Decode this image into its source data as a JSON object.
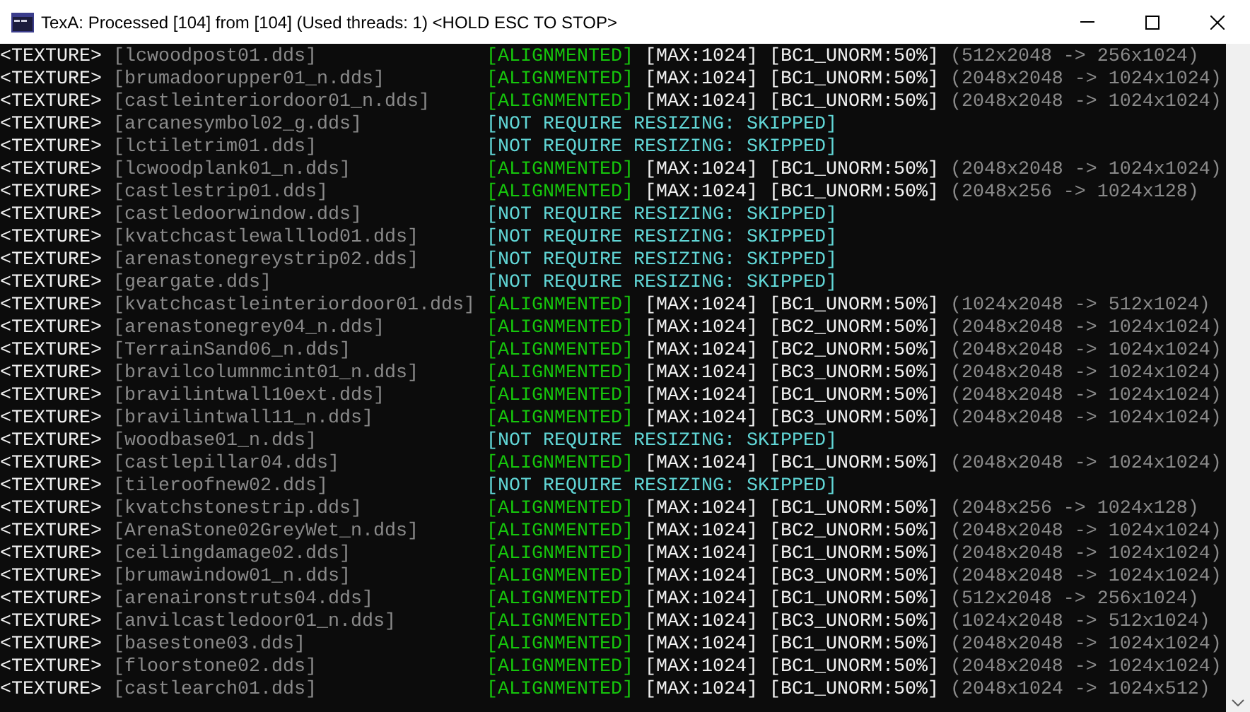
{
  "window": {
    "title": "TexA: Processed [104] from [104] (Used threads: 1) <HOLD ESC TO STOP>"
  },
  "rows": [
    {
      "kind": "aligned",
      "tag": "<TEXTURE>",
      "name": "[lcwoodpost01.dds]",
      "status": "[ALIGNMENTED]",
      "max": "[MAX:1024]",
      "format": "[BC1_UNORM:50%]",
      "dims": "(512x2048 -> 256x1024)"
    },
    {
      "kind": "aligned",
      "tag": "<TEXTURE>",
      "name": "[brumadoorupper01_n.dds]",
      "status": "[ALIGNMENTED]",
      "max": "[MAX:1024]",
      "format": "[BC1_UNORM:50%]",
      "dims": "(2048x2048 -> 1024x1024)"
    },
    {
      "kind": "aligned",
      "tag": "<TEXTURE>",
      "name": "[castleinteriordoor01_n.dds]",
      "status": "[ALIGNMENTED]",
      "max": "[MAX:1024]",
      "format": "[BC1_UNORM:50%]",
      "dims": "(2048x2048 -> 1024x1024)"
    },
    {
      "kind": "skipped",
      "tag": "<TEXTURE>",
      "name": "[arcanesymbol02_g.dds]",
      "status": "[NOT REQUIRE RESIZING: SKIPPED]"
    },
    {
      "kind": "skipped",
      "tag": "<TEXTURE>",
      "name": "[lctiletrim01.dds]",
      "status": "[NOT REQUIRE RESIZING: SKIPPED]"
    },
    {
      "kind": "aligned",
      "tag": "<TEXTURE>",
      "name": "[lcwoodplank01_n.dds]",
      "status": "[ALIGNMENTED]",
      "max": "[MAX:1024]",
      "format": "[BC1_UNORM:50%]",
      "dims": "(2048x2048 -> 1024x1024)"
    },
    {
      "kind": "aligned",
      "tag": "<TEXTURE>",
      "name": "[castlestrip01.dds]",
      "status": "[ALIGNMENTED]",
      "max": "[MAX:1024]",
      "format": "[BC1_UNORM:50%]",
      "dims": "(2048x256 -> 1024x128)"
    },
    {
      "kind": "skipped",
      "tag": "<TEXTURE>",
      "name": "[castledoorwindow.dds]",
      "status": "[NOT REQUIRE RESIZING: SKIPPED]"
    },
    {
      "kind": "skipped",
      "tag": "<TEXTURE>",
      "name": "[kvatchcastlewalllod01.dds]",
      "status": "[NOT REQUIRE RESIZING: SKIPPED]"
    },
    {
      "kind": "skipped",
      "tag": "<TEXTURE>",
      "name": "[arenastonegreystrip02.dds]",
      "status": "[NOT REQUIRE RESIZING: SKIPPED]"
    },
    {
      "kind": "skipped",
      "tag": "<TEXTURE>",
      "name": "[geargate.dds]",
      "status": "[NOT REQUIRE RESIZING: SKIPPED]"
    },
    {
      "kind": "aligned",
      "tag": "<TEXTURE>",
      "name": "[kvatchcastleinteriordoor01.dds]",
      "status": "[ALIGNMENTED]",
      "max": "[MAX:1024]",
      "format": "[BC1_UNORM:50%]",
      "dims": "(1024x2048 -> 512x1024)"
    },
    {
      "kind": "aligned",
      "tag": "<TEXTURE>",
      "name": "[arenastonegrey04_n.dds]",
      "status": "[ALIGNMENTED]",
      "max": "[MAX:1024]",
      "format": "[BC2_UNORM:50%]",
      "dims": "(2048x2048 -> 1024x1024)"
    },
    {
      "kind": "aligned",
      "tag": "<TEXTURE>",
      "name": "[TerrainSand06_n.dds]",
      "status": "[ALIGNMENTED]",
      "max": "[MAX:1024]",
      "format": "[BC2_UNORM:50%]",
      "dims": "(2048x2048 -> 1024x1024)"
    },
    {
      "kind": "aligned",
      "tag": "<TEXTURE>",
      "name": "[bravilcolumnmcint01_n.dds]",
      "status": "[ALIGNMENTED]",
      "max": "[MAX:1024]",
      "format": "[BC3_UNORM:50%]",
      "dims": "(2048x2048 -> 1024x1024)"
    },
    {
      "kind": "aligned",
      "tag": "<TEXTURE>",
      "name": "[bravilintwall10ext.dds]",
      "status": "[ALIGNMENTED]",
      "max": "[MAX:1024]",
      "format": "[BC1_UNORM:50%]",
      "dims": "(2048x2048 -> 1024x1024)"
    },
    {
      "kind": "aligned",
      "tag": "<TEXTURE>",
      "name": "[bravilintwall11_n.dds]",
      "status": "[ALIGNMENTED]",
      "max": "[MAX:1024]",
      "format": "[BC3_UNORM:50%]",
      "dims": "(2048x2048 -> 1024x1024)"
    },
    {
      "kind": "skipped",
      "tag": "<TEXTURE>",
      "name": "[woodbase01_n.dds]",
      "status": "[NOT REQUIRE RESIZING: SKIPPED]"
    },
    {
      "kind": "aligned",
      "tag": "<TEXTURE>",
      "name": "[castlepillar04.dds]",
      "status": "[ALIGNMENTED]",
      "max": "[MAX:1024]",
      "format": "[BC1_UNORM:50%]",
      "dims": "(2048x2048 -> 1024x1024)"
    },
    {
      "kind": "skipped",
      "tag": "<TEXTURE>",
      "name": "[tileroofnew02.dds]",
      "status": "[NOT REQUIRE RESIZING: SKIPPED]"
    },
    {
      "kind": "aligned",
      "tag": "<TEXTURE>",
      "name": "[kvatchstonestrip.dds]",
      "status": "[ALIGNMENTED]",
      "max": "[MAX:1024]",
      "format": "[BC1_UNORM:50%]",
      "dims": "(2048x256 -> 1024x128)"
    },
    {
      "kind": "aligned",
      "tag": "<TEXTURE>",
      "name": "[ArenaStone02GreyWet_n.dds]",
      "status": "[ALIGNMENTED]",
      "max": "[MAX:1024]",
      "format": "[BC2_UNORM:50%]",
      "dims": "(2048x2048 -> 1024x1024)"
    },
    {
      "kind": "aligned",
      "tag": "<TEXTURE>",
      "name": "[ceilingdamage02.dds]",
      "status": "[ALIGNMENTED]",
      "max": "[MAX:1024]",
      "format": "[BC1_UNORM:50%]",
      "dims": "(2048x2048 -> 1024x1024)"
    },
    {
      "kind": "aligned",
      "tag": "<TEXTURE>",
      "name": "[brumawindow01_n.dds]",
      "status": "[ALIGNMENTED]",
      "max": "[MAX:1024]",
      "format": "[BC3_UNORM:50%]",
      "dims": "(2048x2048 -> 1024x1024)"
    },
    {
      "kind": "aligned",
      "tag": "<TEXTURE>",
      "name": "[arenaironstruts04.dds]",
      "status": "[ALIGNMENTED]",
      "max": "[MAX:1024]",
      "format": "[BC1_UNORM:50%]",
      "dims": "(512x2048 -> 256x1024)"
    },
    {
      "kind": "aligned",
      "tag": "<TEXTURE>",
      "name": "[anvilcastledoor01_n.dds]",
      "status": "[ALIGNMENTED]",
      "max": "[MAX:1024]",
      "format": "[BC3_UNORM:50%]",
      "dims": "(1024x2048 -> 512x1024)"
    },
    {
      "kind": "aligned",
      "tag": "<TEXTURE>",
      "name": "[basestone03.dds]",
      "status": "[ALIGNMENTED]",
      "max": "[MAX:1024]",
      "format": "[BC1_UNORM:50%]",
      "dims": "(2048x2048 -> 1024x1024)"
    },
    {
      "kind": "aligned",
      "tag": "<TEXTURE>",
      "name": "[floorstone02.dds]",
      "status": "[ALIGNMENTED]",
      "max": "[MAX:1024]",
      "format": "[BC1_UNORM:50%]",
      "dims": "(2048x2048 -> 1024x1024)"
    },
    {
      "kind": "aligned",
      "tag": "<TEXTURE>",
      "name": "[castlearch01.dds]",
      "status": "[ALIGNMENTED]",
      "max": "[MAX:1024]",
      "format": "[BC1_UNORM:50%]",
      "dims": "(2048x1024 -> 1024x512)"
    }
  ]
}
